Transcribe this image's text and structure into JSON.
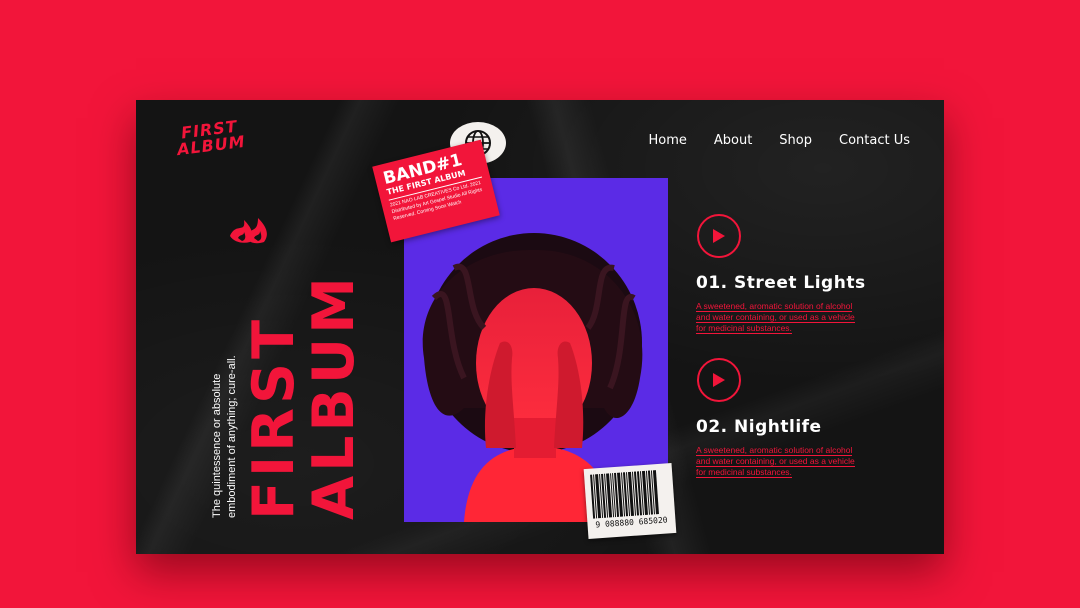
{
  "logo": {
    "line1": "FIRST",
    "line2": "ALBUM"
  },
  "nav": [
    "Home",
    "About",
    "Shop",
    "Contact Us"
  ],
  "hero": {
    "title_line1": "FIRST",
    "title_line2": "ALBUM",
    "tagline_line1": "The quintessence or absolute",
    "tagline_line2": "embodiment of anything; cure-all."
  },
  "sticker": {
    "title": "BAND#1",
    "subtitle": "THE FIRST ALBUM",
    "fine_print": "2021 NAO LAB CREATIVES Co Ltd. 2021 Distributed by Art Gospel Studio All Rights Reserved. Coming Soon Watch"
  },
  "barcode": {
    "number": "9 088880 685020"
  },
  "tracks": [
    {
      "title": "01. Street Lights",
      "desc_line1": "A sweetened, aromatic solution of alcohol",
      "desc_line2": "and water containing, or used as a vehicle",
      "desc_line3": "for medicinal substances."
    },
    {
      "title": "02. Nightlife",
      "desc_line1": "A sweetened, aromatic solution of alcohol",
      "desc_line2": "and water containing, or used as a vehicle",
      "desc_line3": "for medicinal substances."
    }
  ],
  "colors": {
    "accent": "#f2153a",
    "card": "#141414",
    "photo_bg": "#5b2be6",
    "text": "#ffffff"
  },
  "icons": [
    "globe-icon",
    "flame-icon",
    "play-icon"
  ]
}
